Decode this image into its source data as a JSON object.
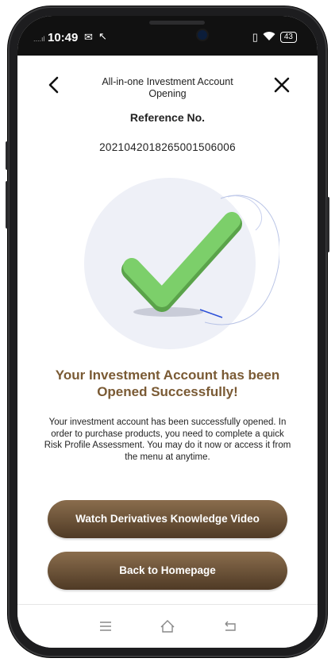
{
  "status_bar": {
    "time": "10:49",
    "signal_left": "....ıl",
    "battery": "43"
  },
  "header": {
    "title_line1": "All-in-one Investment Account",
    "title_line2": "Opening",
    "reference_label": "Reference No.",
    "reference_number": "20210420182650015060​06"
  },
  "result": {
    "title_line1": "Your Investment Account has been",
    "title_line2": "Opened Successfully!",
    "description": "Your investment account has been successfully opened. In order to purchase products, you need to complete a quick Risk Profile Assessment. You may do it now or access it from the menu at anytime."
  },
  "actions": {
    "video_label": "Watch Derivatives Knowledge Video",
    "home_label": "Back to Homepage"
  },
  "icons": {
    "back": "chevron-left-icon",
    "close": "close-icon",
    "success": "check-mark-icon",
    "menu": "menu-icon",
    "home": "home-icon",
    "return": "return-icon"
  },
  "colors": {
    "accent_text": "#7a5a34",
    "button_top": "#8a6d4d",
    "button_bottom": "#4f3a25",
    "check_green": "#7ccf6a"
  }
}
